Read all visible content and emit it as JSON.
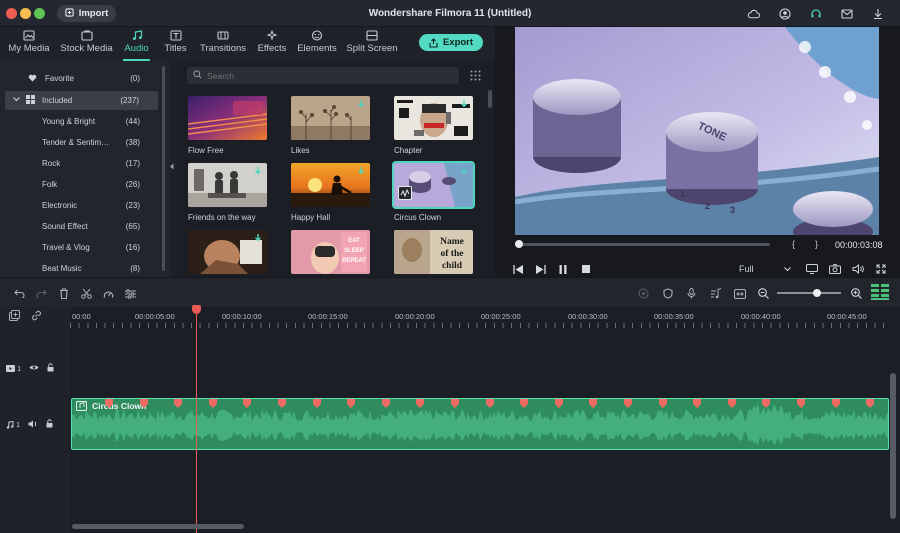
{
  "app": {
    "title": "Wondershare Filmora 11 (Untitled)",
    "import_label": "Import",
    "export_label": "Export"
  },
  "tabs": [
    {
      "label": "My Media",
      "icon": "media-icon"
    },
    {
      "label": "Stock Media",
      "icon": "stock-icon"
    },
    {
      "label": "Audio",
      "icon": "music-note-icon",
      "active": true
    },
    {
      "label": "Titles",
      "icon": "titles-icon"
    },
    {
      "label": "Transitions",
      "icon": "transitions-icon"
    },
    {
      "label": "Effects",
      "icon": "effects-icon"
    },
    {
      "label": "Elements",
      "icon": "elements-icon"
    },
    {
      "label": "Split Screen",
      "icon": "split-screen-icon"
    }
  ],
  "sidebar": {
    "items": [
      {
        "label": "Favorite",
        "count": "(0)"
      },
      {
        "label": "Included",
        "count": "(237)",
        "selected": true
      },
      {
        "label": "Young & Bright",
        "count": "(44)"
      },
      {
        "label": "Tender & Sentim…",
        "count": "(38)"
      },
      {
        "label": "Rock",
        "count": "(17)"
      },
      {
        "label": "Folk",
        "count": "(26)"
      },
      {
        "label": "Electronic",
        "count": "(23)"
      },
      {
        "label": "Sound Effect",
        "count": "(65)"
      },
      {
        "label": "Travel & Vlog",
        "count": "(16)"
      },
      {
        "label": "Beat Music",
        "count": "(8)"
      }
    ]
  },
  "library": {
    "search_placeholder": "Search",
    "items": [
      {
        "label": "Flow Free"
      },
      {
        "label": "Likes"
      },
      {
        "label": "Chapter"
      },
      {
        "label": "Friends on the way"
      },
      {
        "label": "Happy Hall"
      },
      {
        "label": "Circus Clown",
        "selected": true
      },
      {
        "label": ""
      },
      {
        "label": ""
      },
      {
        "label": ""
      }
    ],
    "thumb_text": {
      "eat_sleep": [
        "EAT",
        "SLEEP",
        "REPEAT"
      ],
      "name_child": [
        "Name",
        "of the",
        "child"
      ]
    }
  },
  "preview": {
    "timecode": "00:00:03:08",
    "brace_open": "{",
    "brace_close": "}",
    "quality": "Full",
    "knob_label": "TONE",
    "dial_numbers": [
      "1",
      "2",
      "3"
    ],
    "progress": 0.0
  },
  "timeline": {
    "ruler_labels": [
      "00:00",
      "00:00:05:00",
      "00:00:10:00",
      "00:00:15:00",
      "00:00:20:00",
      "00:00:25:00",
      "00:00:30:00",
      "00:00:35:00",
      "00:00:40:00",
      "00:00:45:00"
    ],
    "video_track": {
      "number": "1"
    },
    "audio_track": {
      "number": "1"
    },
    "clip_title": "Circus Clown",
    "zoom_level": 0.55
  },
  "colors": {
    "accent": "#4fd6bf",
    "playhead": "#e85a54",
    "clip_fill": "#2e8c5e",
    "clip_border": "#5fe0b0"
  }
}
